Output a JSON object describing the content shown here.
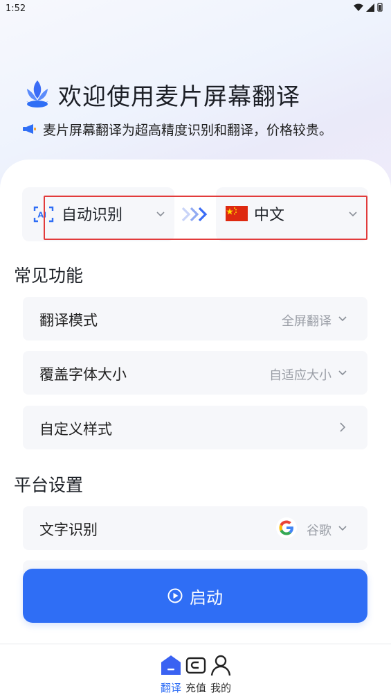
{
  "status_bar": {
    "time": "1:52"
  },
  "hero": {
    "title": "欢迎使用麦片屏幕翻译",
    "notice": "麦片屏幕翻译为超高精度识别和翻译，价格较贵。"
  },
  "language_bar": {
    "source_label": "自动识别",
    "target_label": "中文"
  },
  "common_section": {
    "title": "常见功能",
    "rows": [
      {
        "label": "翻译模式",
        "value": "全屏翻译"
      },
      {
        "label": "覆盖字体大小",
        "value": "自适应大小"
      },
      {
        "label": "自定义样式",
        "value": ""
      }
    ]
  },
  "platform_section": {
    "title": "平台设置",
    "rows": [
      {
        "label": "文字识别",
        "value": "谷歌"
      }
    ]
  },
  "start_button": {
    "label": "启动"
  },
  "bottom_nav": {
    "tabs": [
      {
        "label": "翻译",
        "icon": "home-icon",
        "active": true
      },
      {
        "label": "充值",
        "icon": "wallet-icon",
        "active": false
      },
      {
        "label": "我的",
        "icon": "person-icon",
        "active": false
      }
    ]
  },
  "colors": {
    "accent": "#2f6ef5",
    "highlight_box": "#e23b3b",
    "row_bg": "#f6f7fa"
  }
}
